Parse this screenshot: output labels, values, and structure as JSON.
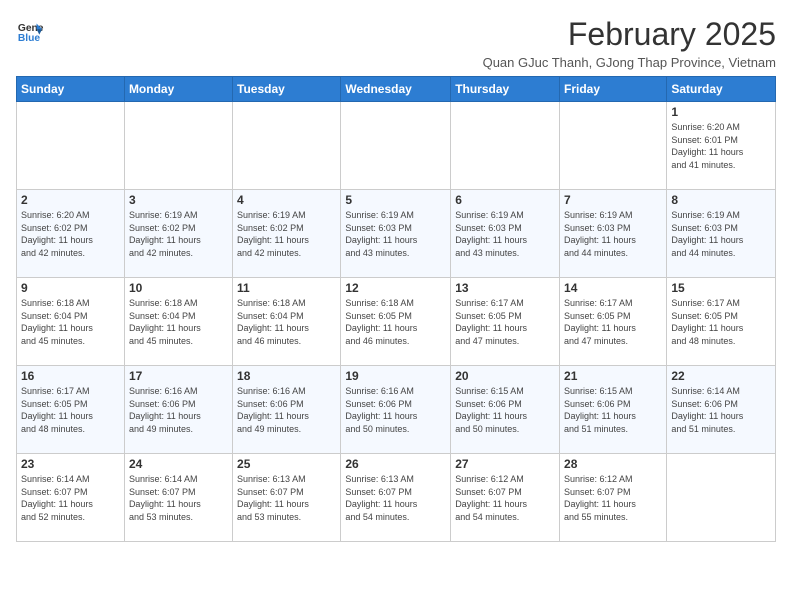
{
  "header": {
    "logo_line1": "General",
    "logo_line2": "Blue",
    "month_title": "February 2025",
    "subtitle": "Quan GJuc Thanh, GJong Thap Province, Vietnam"
  },
  "weekdays": [
    "Sunday",
    "Monday",
    "Tuesday",
    "Wednesday",
    "Thursday",
    "Friday",
    "Saturday"
  ],
  "weeks": [
    [
      {
        "day": "",
        "info": ""
      },
      {
        "day": "",
        "info": ""
      },
      {
        "day": "",
        "info": ""
      },
      {
        "day": "",
        "info": ""
      },
      {
        "day": "",
        "info": ""
      },
      {
        "day": "",
        "info": ""
      },
      {
        "day": "1",
        "info": "Sunrise: 6:20 AM\nSunset: 6:01 PM\nDaylight: 11 hours\nand 41 minutes."
      }
    ],
    [
      {
        "day": "2",
        "info": "Sunrise: 6:20 AM\nSunset: 6:02 PM\nDaylight: 11 hours\nand 42 minutes."
      },
      {
        "day": "3",
        "info": "Sunrise: 6:19 AM\nSunset: 6:02 PM\nDaylight: 11 hours\nand 42 minutes."
      },
      {
        "day": "4",
        "info": "Sunrise: 6:19 AM\nSunset: 6:02 PM\nDaylight: 11 hours\nand 42 minutes."
      },
      {
        "day": "5",
        "info": "Sunrise: 6:19 AM\nSunset: 6:03 PM\nDaylight: 11 hours\nand 43 minutes."
      },
      {
        "day": "6",
        "info": "Sunrise: 6:19 AM\nSunset: 6:03 PM\nDaylight: 11 hours\nand 43 minutes."
      },
      {
        "day": "7",
        "info": "Sunrise: 6:19 AM\nSunset: 6:03 PM\nDaylight: 11 hours\nand 44 minutes."
      },
      {
        "day": "8",
        "info": "Sunrise: 6:19 AM\nSunset: 6:03 PM\nDaylight: 11 hours\nand 44 minutes."
      }
    ],
    [
      {
        "day": "9",
        "info": "Sunrise: 6:18 AM\nSunset: 6:04 PM\nDaylight: 11 hours\nand 45 minutes."
      },
      {
        "day": "10",
        "info": "Sunrise: 6:18 AM\nSunset: 6:04 PM\nDaylight: 11 hours\nand 45 minutes."
      },
      {
        "day": "11",
        "info": "Sunrise: 6:18 AM\nSunset: 6:04 PM\nDaylight: 11 hours\nand 46 minutes."
      },
      {
        "day": "12",
        "info": "Sunrise: 6:18 AM\nSunset: 6:05 PM\nDaylight: 11 hours\nand 46 minutes."
      },
      {
        "day": "13",
        "info": "Sunrise: 6:17 AM\nSunset: 6:05 PM\nDaylight: 11 hours\nand 47 minutes."
      },
      {
        "day": "14",
        "info": "Sunrise: 6:17 AM\nSunset: 6:05 PM\nDaylight: 11 hours\nand 47 minutes."
      },
      {
        "day": "15",
        "info": "Sunrise: 6:17 AM\nSunset: 6:05 PM\nDaylight: 11 hours\nand 48 minutes."
      }
    ],
    [
      {
        "day": "16",
        "info": "Sunrise: 6:17 AM\nSunset: 6:05 PM\nDaylight: 11 hours\nand 48 minutes."
      },
      {
        "day": "17",
        "info": "Sunrise: 6:16 AM\nSunset: 6:06 PM\nDaylight: 11 hours\nand 49 minutes."
      },
      {
        "day": "18",
        "info": "Sunrise: 6:16 AM\nSunset: 6:06 PM\nDaylight: 11 hours\nand 49 minutes."
      },
      {
        "day": "19",
        "info": "Sunrise: 6:16 AM\nSunset: 6:06 PM\nDaylight: 11 hours\nand 50 minutes."
      },
      {
        "day": "20",
        "info": "Sunrise: 6:15 AM\nSunset: 6:06 PM\nDaylight: 11 hours\nand 50 minutes."
      },
      {
        "day": "21",
        "info": "Sunrise: 6:15 AM\nSunset: 6:06 PM\nDaylight: 11 hours\nand 51 minutes."
      },
      {
        "day": "22",
        "info": "Sunrise: 6:14 AM\nSunset: 6:06 PM\nDaylight: 11 hours\nand 51 minutes."
      }
    ],
    [
      {
        "day": "23",
        "info": "Sunrise: 6:14 AM\nSunset: 6:07 PM\nDaylight: 11 hours\nand 52 minutes."
      },
      {
        "day": "24",
        "info": "Sunrise: 6:14 AM\nSunset: 6:07 PM\nDaylight: 11 hours\nand 53 minutes."
      },
      {
        "day": "25",
        "info": "Sunrise: 6:13 AM\nSunset: 6:07 PM\nDaylight: 11 hours\nand 53 minutes."
      },
      {
        "day": "26",
        "info": "Sunrise: 6:13 AM\nSunset: 6:07 PM\nDaylight: 11 hours\nand 54 minutes."
      },
      {
        "day": "27",
        "info": "Sunrise: 6:12 AM\nSunset: 6:07 PM\nDaylight: 11 hours\nand 54 minutes."
      },
      {
        "day": "28",
        "info": "Sunrise: 6:12 AM\nSunset: 6:07 PM\nDaylight: 11 hours\nand 55 minutes."
      },
      {
        "day": "",
        "info": ""
      }
    ]
  ]
}
